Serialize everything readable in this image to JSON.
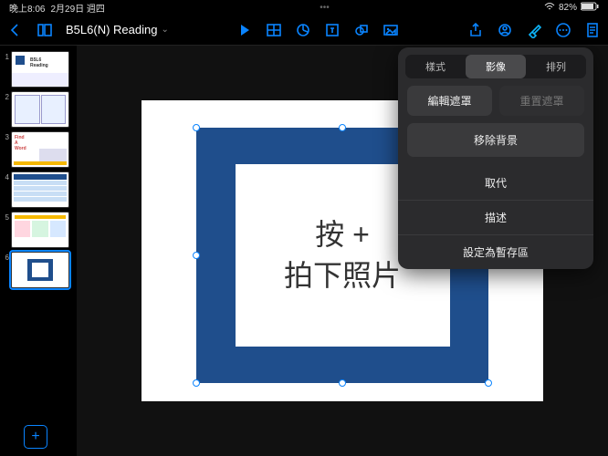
{
  "status": {
    "time": "晚上8:06",
    "date": "2月29日 週四",
    "battery": "82%"
  },
  "toolbar": {
    "title": "B5L6(N) Reading"
  },
  "sidebar": {
    "slides": [
      1,
      2,
      3,
      4,
      5,
      6
    ],
    "selected": 6
  },
  "slide": {
    "line1": "按 +",
    "line2": "拍下照片"
  },
  "popover": {
    "tabs": {
      "style": "樣式",
      "image": "影像",
      "arrange": "排列"
    },
    "edit_mask": "編輯遮罩",
    "reset_mask": "重置遮罩",
    "remove_bg": "移除背景",
    "replace": "取代",
    "describe": "描述",
    "set_placeholder": "設定為暫存區"
  }
}
